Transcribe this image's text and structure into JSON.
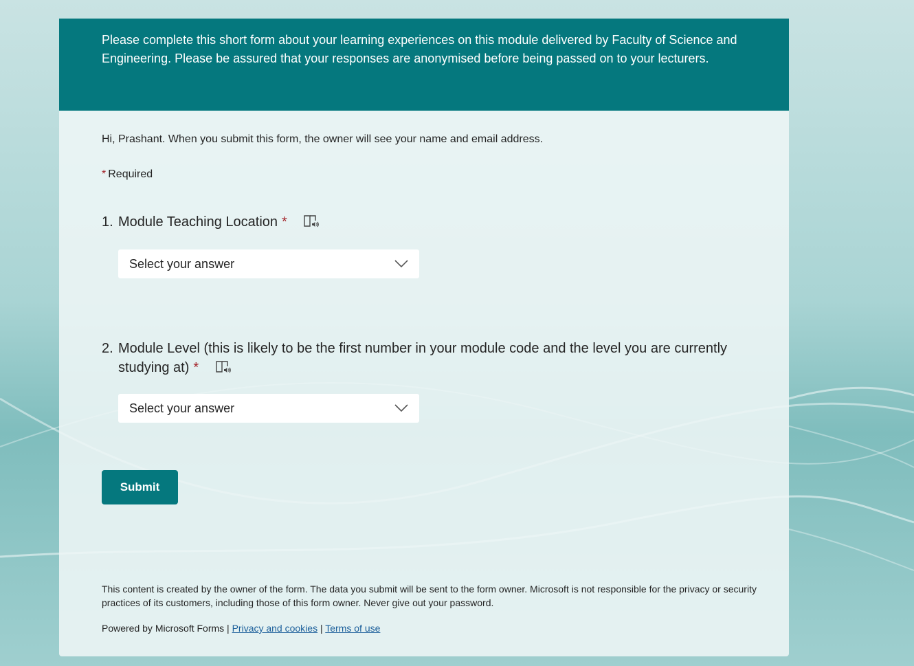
{
  "header": {
    "description": "Please complete this short form about your learning experiences on this module delivered by Faculty of Science and Engineering. Please be assured that your responses are anonymised before being passed on to your lecturers."
  },
  "form": {
    "greeting": "Hi, Prashant. When you submit this form, the owner will see your name and email address.",
    "required_star": "*",
    "required_label": "Required",
    "questions": [
      {
        "number": "1.",
        "title": "Module Teaching Location",
        "required_star": "*",
        "placeholder": "Select your answer"
      },
      {
        "number": "2.",
        "title": "Module Level (this is likely to be the first number in your module code and the level you are currently studying at)",
        "required_star": "*",
        "placeholder": "Select your answer"
      }
    ],
    "submit_label": "Submit"
  },
  "footer": {
    "disclaimer": "This content is created by the owner of the form. The data you submit will be sent to the form owner. Microsoft is not responsible for the privacy or security practices of its customers, including those of this form owner. Never give out your password.",
    "powered_by": "Powered by Microsoft Forms |",
    "separator": "|",
    "privacy_link": "Privacy and cookies",
    "terms_link": "Terms of use"
  },
  "icons": {
    "reader": "immersive-reader-icon",
    "dropdown": "chevron-down-icon"
  },
  "colors": {
    "brand": "#05787e",
    "required": "#a4262c",
    "link": "#1a5e9a"
  }
}
